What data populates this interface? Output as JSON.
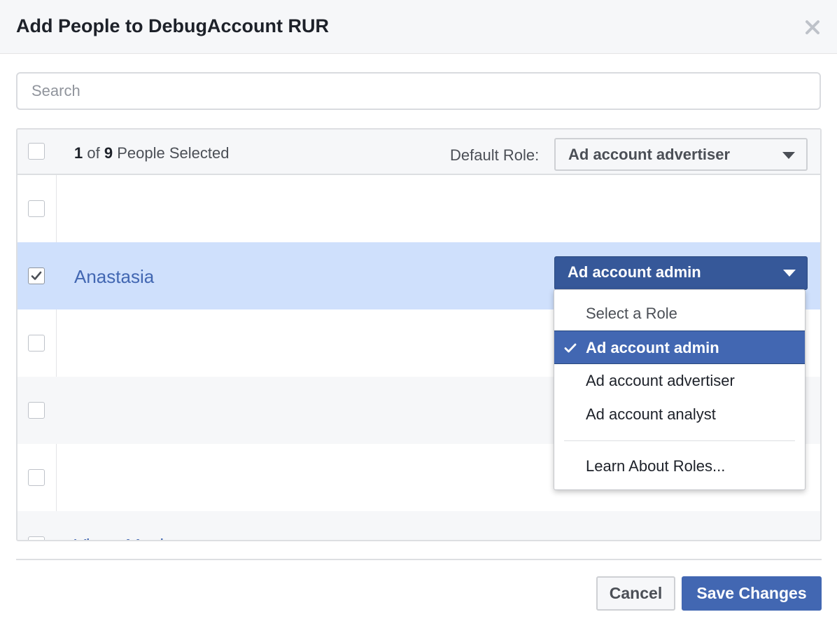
{
  "dialog": {
    "title": "Add People to DebugAccount RUR",
    "close_icon": "close-icon"
  },
  "search": {
    "placeholder": "Search",
    "value": ""
  },
  "list_header": {
    "selected_count": "1",
    "of_text": "of",
    "total_count": "9",
    "people_selected_text": "People Selected",
    "default_role_label": "Default Role:",
    "default_role_value": "Ad account advertiser"
  },
  "rows": [
    {
      "name": "",
      "checked": false
    },
    {
      "name": "Anastasia",
      "checked": true,
      "role": "Ad account admin"
    },
    {
      "name": "",
      "checked": false
    },
    {
      "name": "",
      "checked": false
    },
    {
      "name": "",
      "checked": false
    },
    {
      "name": "Victor Mack",
      "checked": false
    }
  ],
  "role_menu": {
    "items": [
      "Select a Role",
      "Ad account admin",
      "Ad account advertiser",
      "Ad account analyst"
    ],
    "selected_index": 1,
    "learn_more": "Learn About Roles..."
  },
  "footer": {
    "cancel_label": "Cancel",
    "save_label": "Save Changes"
  },
  "colors": {
    "accent": "#4267b2",
    "accent_dark": "#365899",
    "row_selected": "#cfe0fc",
    "link": "#4267b2"
  }
}
